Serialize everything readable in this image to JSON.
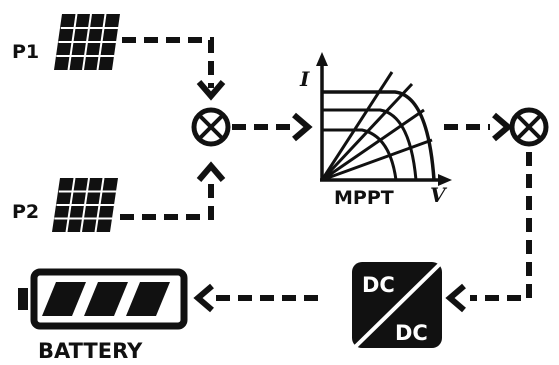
{
  "labels": {
    "panel1": "P1",
    "panel2": "P2",
    "mppt": "MPPT",
    "axis_i": "I",
    "axis_v": "V",
    "dc_top": "DC",
    "dc_bottom": "DC",
    "battery": "BATTERY"
  },
  "colors": {
    "ink": "#111111",
    "background": "#ffffff"
  },
  "icons": [
    "solar-panel-icon",
    "summing-junction-icon",
    "mppt-chart-icon",
    "dc-dc-converter-icon",
    "battery-icon",
    "arrow-icon"
  ]
}
